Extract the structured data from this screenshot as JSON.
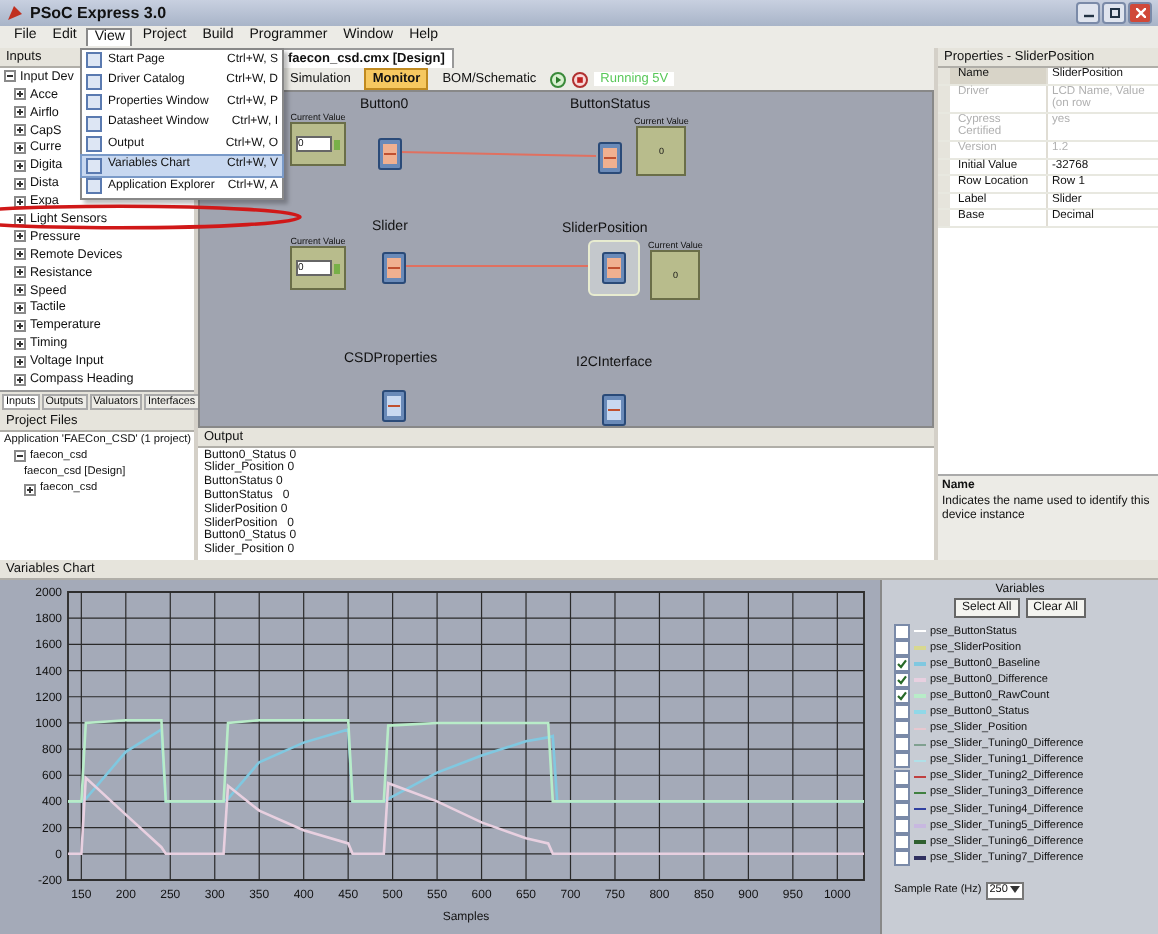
{
  "window": {
    "title": "PSoC Express 3.0"
  },
  "menu_bar": [
    {
      "label": "File",
      "selected": false
    },
    {
      "label": "Edit",
      "selected": false
    },
    {
      "label": "View",
      "selected": true
    },
    {
      "label": "Project",
      "selected": false
    },
    {
      "label": "Build",
      "selected": false
    },
    {
      "label": "Programmer",
      "selected": false
    },
    {
      "label": "Window",
      "selected": false
    },
    {
      "label": "Help",
      "selected": false
    }
  ],
  "view_menu": [
    {
      "label": "Start Page",
      "shortcut": "Ctrl+W, S",
      "selected": false
    },
    {
      "label": "Driver Catalog",
      "shortcut": "Ctrl+W, D",
      "selected": false
    },
    {
      "label": "Properties Window",
      "shortcut": "Ctrl+W, P",
      "selected": false
    },
    {
      "label": "Datasheet Window",
      "shortcut": "Ctrl+W, I",
      "selected": false
    },
    {
      "label": "Output",
      "shortcut": "Ctrl+W, O",
      "selected": false
    },
    {
      "label": "Variables Chart",
      "shortcut": "Ctrl+W, V",
      "selected": true
    },
    {
      "label": "Application Explorer",
      "shortcut": "Ctrl+W, A",
      "selected": false
    }
  ],
  "inputs_panel": {
    "title": "Inputs",
    "tree": [
      {
        "label": "Input Dev",
        "expanded": true,
        "children": [
          {
            "label": "Acce",
            "expanded": false
          },
          {
            "label": "Airflo",
            "expanded": false
          },
          {
            "label": "CapS",
            "expanded": false
          },
          {
            "label": "Curre",
            "expanded": false
          },
          {
            "label": "Digita",
            "expanded": false
          },
          {
            "label": "Dista",
            "expanded": false
          },
          {
            "label": "Expa",
            "expanded": false
          },
          {
            "label": "Light Sensors",
            "expanded": false
          },
          {
            "label": "Pressure",
            "expanded": false
          },
          {
            "label": "Remote Devices",
            "expanded": false
          },
          {
            "label": "Resistance",
            "expanded": false
          },
          {
            "label": "Speed",
            "expanded": false
          },
          {
            "label": "Tactile",
            "expanded": false
          },
          {
            "label": "Temperature",
            "expanded": false
          },
          {
            "label": "Timing",
            "expanded": false
          },
          {
            "label": "Voltage Input",
            "expanded": false
          },
          {
            "label": "Compass Heading",
            "expanded": false
          }
        ]
      }
    ]
  },
  "panel_tabs": [
    {
      "label": "Inputs",
      "selected": true
    },
    {
      "label": "Outputs",
      "selected": false
    },
    {
      "label": "Valuators",
      "selected": false
    },
    {
      "label": "Interfaces",
      "selected": false
    }
  ],
  "project_files": {
    "title": "Project Files",
    "tree": [
      {
        "label": "Application 'FAECon_CSD' (1 project)",
        "children": [
          {
            "label": "faecon_csd",
            "expanded": true,
            "children": [
              {
                "label": "faecon_csd [Design]"
              },
              {
                "label": "faecon_csd",
                "expanded": false
              }
            ]
          }
        ]
      }
    ]
  },
  "document_tab": {
    "label": "faecon_csd.cmx [Design]"
  },
  "toolbar": [
    {
      "kind": "button",
      "label": "Simulation",
      "selected": false
    },
    {
      "kind": "button",
      "label": "Monitor",
      "selected": true
    },
    {
      "kind": "button",
      "label": "BOM/Schematic",
      "selected": false
    },
    {
      "kind": "play"
    },
    {
      "kind": "stop"
    },
    {
      "kind": "status",
      "label": "Running 5V"
    }
  ],
  "canvas": {
    "widgets": [
      {
        "kind": "input",
        "caption": "Current Value",
        "value": "0"
      },
      {
        "kind": "display",
        "caption": "Current Value",
        "value": "0"
      },
      {
        "kind": "input",
        "caption": "Current Value",
        "value": "0"
      },
      {
        "kind": "display",
        "caption": "Current Value",
        "value": "0"
      }
    ],
    "devices": [
      {
        "name": "Button0",
        "selected": false
      },
      {
        "name": "ButtonStatus",
        "selected": false
      },
      {
        "name": "Slider",
        "selected": false
      },
      {
        "name": "SliderPosition",
        "selected": true
      },
      {
        "name": "CSDProperties",
        "selected": false
      },
      {
        "name": "I2CInterface",
        "selected": false
      }
    ]
  },
  "output": {
    "title": "Output",
    "lines": [
      "Button0_Status 0",
      "Slider_Position 0",
      "ButtonStatus 0",
      "ButtonStatus   0",
      "SliderPosition 0",
      "SliderPosition   0",
      "Button0_Status 0",
      "Slider_Position 0"
    ]
  },
  "properties": {
    "title": "Properties - SliderPosition",
    "rows": [
      {
        "name": "Name",
        "value": "SliderPosition",
        "disabled": false,
        "selected": true
      },
      {
        "name": "Driver",
        "value": "LCD Name, Value (on row",
        "disabled": true,
        "selected": false
      },
      {
        "name": "Cypress Certified",
        "value": "yes",
        "disabled": true,
        "selected": false
      },
      {
        "name": "Version",
        "value": "1.2",
        "disabled": true,
        "selected": false
      },
      {
        "name": "Initial Value",
        "value": "-32768",
        "disabled": false,
        "selected": false
      },
      {
        "name": "Row Location",
        "value": "Row 1",
        "disabled": false,
        "selected": false
      },
      {
        "name": "Label",
        "value": "Slider",
        "disabled": false,
        "selected": false
      },
      {
        "name": "Base",
        "value": "Decimal",
        "disabled": false,
        "selected": false
      }
    ],
    "description": {
      "title": "Name",
      "text": "Indicates the name used to identify this device instance"
    }
  },
  "variables_chart": {
    "title": "Variables Chart",
    "chart_data": {
      "type": "line",
      "grid": true,
      "xlabel": "Samples",
      "xlim": [
        135,
        1030
      ],
      "ylim": [
        -200,
        2000
      ],
      "xticks": [
        150,
        200,
        250,
        300,
        350,
        400,
        450,
        500,
        550,
        600,
        650,
        700,
        750,
        800,
        850,
        900,
        950,
        1000
      ],
      "yticks": [
        -200,
        0,
        200,
        400,
        600,
        800,
        1000,
        1200,
        1400,
        1600,
        1800,
        2000
      ],
      "x": [
        135,
        150,
        155,
        200,
        240,
        245,
        250,
        310,
        315,
        350,
        400,
        450,
        455,
        460,
        490,
        495,
        550,
        600,
        650,
        675,
        680,
        685,
        700,
        1030
      ],
      "series": [
        {
          "color": "#80c8e0",
          "values": [
            400,
            400,
            420,
            780,
            950,
            400,
            400,
            400,
            420,
            700,
            850,
            950,
            400,
            400,
            400,
            420,
            620,
            750,
            860,
            890,
            900,
            400,
            400,
            400
          ]
        },
        {
          "color": "#e8d0e0",
          "values": [
            0,
            0,
            580,
            300,
            50,
            0,
            0,
            0,
            520,
            330,
            180,
            80,
            0,
            0,
            0,
            540,
            400,
            240,
            120,
            80,
            0,
            0,
            0,
            0
          ]
        },
        {
          "color": "#b8ecc8",
          "values": [
            400,
            400,
            1000,
            1020,
            1020,
            400,
            400,
            400,
            1000,
            1020,
            1020,
            1020,
            400,
            400,
            400,
            980,
            1000,
            1000,
            1000,
            1000,
            400,
            400,
            400,
            400
          ]
        }
      ]
    }
  },
  "variables": {
    "title": "Variables",
    "buttons": [
      "Select All",
      "Clear All"
    ],
    "items": [
      {
        "name": "pse_ButtonStatus",
        "color": "#ffffff",
        "checked": false
      },
      {
        "name": "pse_SliderPosition",
        "color": "#d8d890",
        "checked": false
      },
      {
        "name": "pse_Button0_Baseline",
        "color": "#80c8e0",
        "checked": true
      },
      {
        "name": "pse_Button0_Difference",
        "color": "#e8d0e0",
        "checked": true
      },
      {
        "name": "pse_Button0_RawCount",
        "color": "#b8ecc8",
        "checked": true
      },
      {
        "name": "pse_Button0_Status",
        "color": "#90d8e8",
        "checked": false
      },
      {
        "name": "pse_Slider_Position",
        "color": "#e8c8d0",
        "checked": false
      },
      {
        "name": "pse_Slider_Tuning0_Difference",
        "color": "#80a090",
        "checked": false
      },
      {
        "name": "pse_Slider_Tuning1_Difference",
        "color": "#b0e0e8",
        "checked": false
      },
      {
        "name": "pse_Slider_Tuning2_Difference",
        "color": "#c04040",
        "checked": false
      },
      {
        "name": "pse_Slider_Tuning3_Difference",
        "color": "#408040",
        "checked": false
      },
      {
        "name": "pse_Slider_Tuning4_Difference",
        "color": "#3040a0",
        "checked": false
      },
      {
        "name": "pse_Slider_Tuning5_Difference",
        "color": "#c8b8e0",
        "checked": false
      },
      {
        "name": "pse_Slider_Tuning6_Difference",
        "color": "#306030",
        "checked": false
      },
      {
        "name": "pse_Slider_Tuning7_Difference",
        "color": "#303060",
        "checked": false
      }
    ],
    "sample_rate": {
      "label": "Sample Rate (Hz)",
      "value": "250"
    }
  }
}
